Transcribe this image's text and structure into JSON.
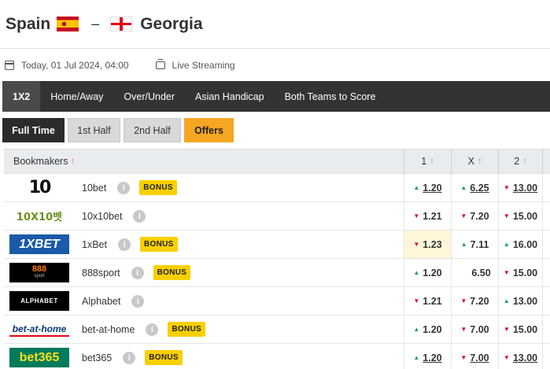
{
  "match": {
    "home_team": "Spain",
    "separator": "–",
    "away_team": "Georgia",
    "date_text": "Today, 01 Jul 2024, 04:00",
    "streaming_text": "Live Streaming"
  },
  "market_tabs": [
    "1X2",
    "Home/Away",
    "Over/Under",
    "Asian Handicap",
    "Both Teams to Score"
  ],
  "period_tabs": [
    "Full Time",
    "1st Half",
    "2nd Half",
    "Offers"
  ],
  "table": {
    "header": {
      "bookmakers": "Bookmakers",
      "col1": "1",
      "colx": "X",
      "col2": "2"
    },
    "bonus_label": "BONUS",
    "info_glyph": "i",
    "rows": [
      {
        "name": "10bet",
        "logo_text": "10",
        "bonus": true,
        "odds": [
          {
            "v": "1.20",
            "dir": "up",
            "ul": true
          },
          {
            "v": "6.25",
            "dir": "up",
            "ul": true
          },
          {
            "v": "13.00",
            "dir": "down",
            "ul": true
          }
        ]
      },
      {
        "name": "10x10bet",
        "logo_text": "10X10벳",
        "bonus": false,
        "odds": [
          {
            "v": "1.21",
            "dir": "down",
            "ul": false
          },
          {
            "v": "7.20",
            "dir": "down",
            "ul": false
          },
          {
            "v": "15.00",
            "dir": "down",
            "ul": false
          }
        ]
      },
      {
        "name": "1xBet",
        "logo_text": "1XBET",
        "bonus": true,
        "odds": [
          {
            "v": "1.23",
            "dir": "down",
            "ul": false,
            "hl": true
          },
          {
            "v": "7.11",
            "dir": "up",
            "ul": false
          },
          {
            "v": "16.00",
            "dir": "up",
            "ul": false
          }
        ]
      },
      {
        "name": "888sport",
        "logo_text": "888",
        "logo_sub": "sport",
        "bonus": true,
        "odds": [
          {
            "v": "1.20",
            "dir": "up",
            "ul": false
          },
          {
            "v": "6.50",
            "dir": "none",
            "ul": false
          },
          {
            "v": "15.00",
            "dir": "down",
            "ul": false
          }
        ]
      },
      {
        "name": "Alphabet",
        "logo_text": "ALPHABET",
        "bonus": false,
        "odds": [
          {
            "v": "1.21",
            "dir": "down",
            "ul": false
          },
          {
            "v": "7.20",
            "dir": "down",
            "ul": false
          },
          {
            "v": "13.00",
            "dir": "up",
            "ul": false
          }
        ]
      },
      {
        "name": "bet-at-home",
        "logo_text": "bet-at-home",
        "bonus": true,
        "odds": [
          {
            "v": "1.20",
            "dir": "up",
            "ul": false
          },
          {
            "v": "7.00",
            "dir": "down",
            "ul": false
          },
          {
            "v": "15.00",
            "dir": "down",
            "ul": false
          }
        ]
      },
      {
        "name": "bet365",
        "logo_text": "bet365",
        "bonus": true,
        "odds": [
          {
            "v": "1.20",
            "dir": "up",
            "ul": true
          },
          {
            "v": "7.00",
            "dir": "down",
            "ul": true
          },
          {
            "v": "13.00",
            "dir": "down",
            "ul": true
          }
        ]
      }
    ]
  },
  "colors": {
    "accent": "#f5a623",
    "up": "#1aa260",
    "down": "#e0002a",
    "dark_bar": "#333333"
  }
}
